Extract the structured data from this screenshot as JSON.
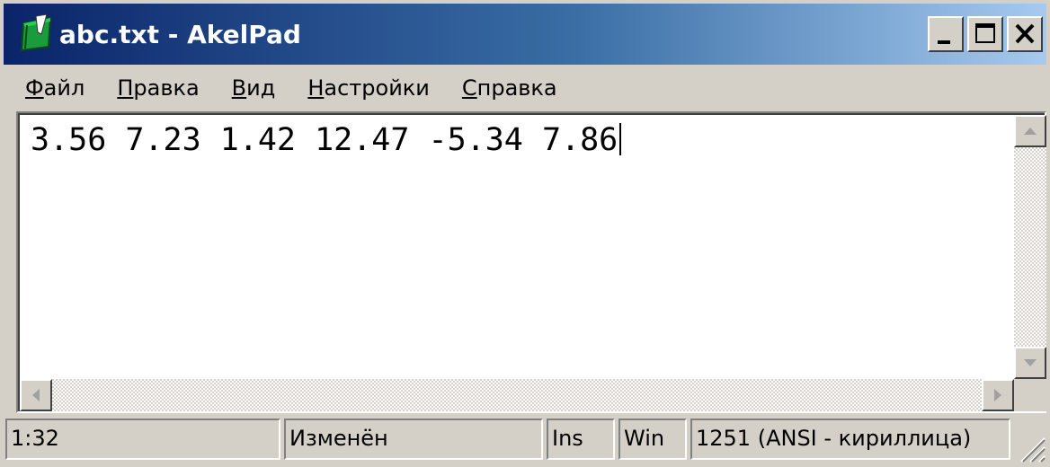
{
  "window": {
    "title": "abc.txt - AkelPad",
    "buttons": {
      "minimize": "minimize",
      "maximize": "maximize",
      "close": "close"
    }
  },
  "menu": {
    "items": [
      {
        "first": "Ф",
        "rest": "айл"
      },
      {
        "first": "П",
        "rest": "равка"
      },
      {
        "first": "В",
        "rest": "ид"
      },
      {
        "first": "Н",
        "rest": "астройки"
      },
      {
        "first": "С",
        "rest": "правка"
      }
    ]
  },
  "editor": {
    "content": "3.56 7.23 1.42 12.47 -5.34 7.86"
  },
  "statusbar": {
    "position": "1:32",
    "modified": "Изменён",
    "insert_mode": "Ins",
    "newline": "Win",
    "encoding": "1251  (ANSI - кириллица)"
  },
  "icons": {
    "app": "akelpad-notebook-icon",
    "minimize": "minimize-icon",
    "maximize": "maximize-icon",
    "close": "close-icon",
    "scroll_up": "arrow-up-icon",
    "scroll_down": "arrow-down-icon",
    "scroll_left": "arrow-left-icon",
    "scroll_right": "arrow-right-icon",
    "resize": "size-grip-icon"
  },
  "colors": {
    "titlebar_start": "#0a246a",
    "titlebar_end": "#a6caf0",
    "face": "#d4d0c8"
  }
}
